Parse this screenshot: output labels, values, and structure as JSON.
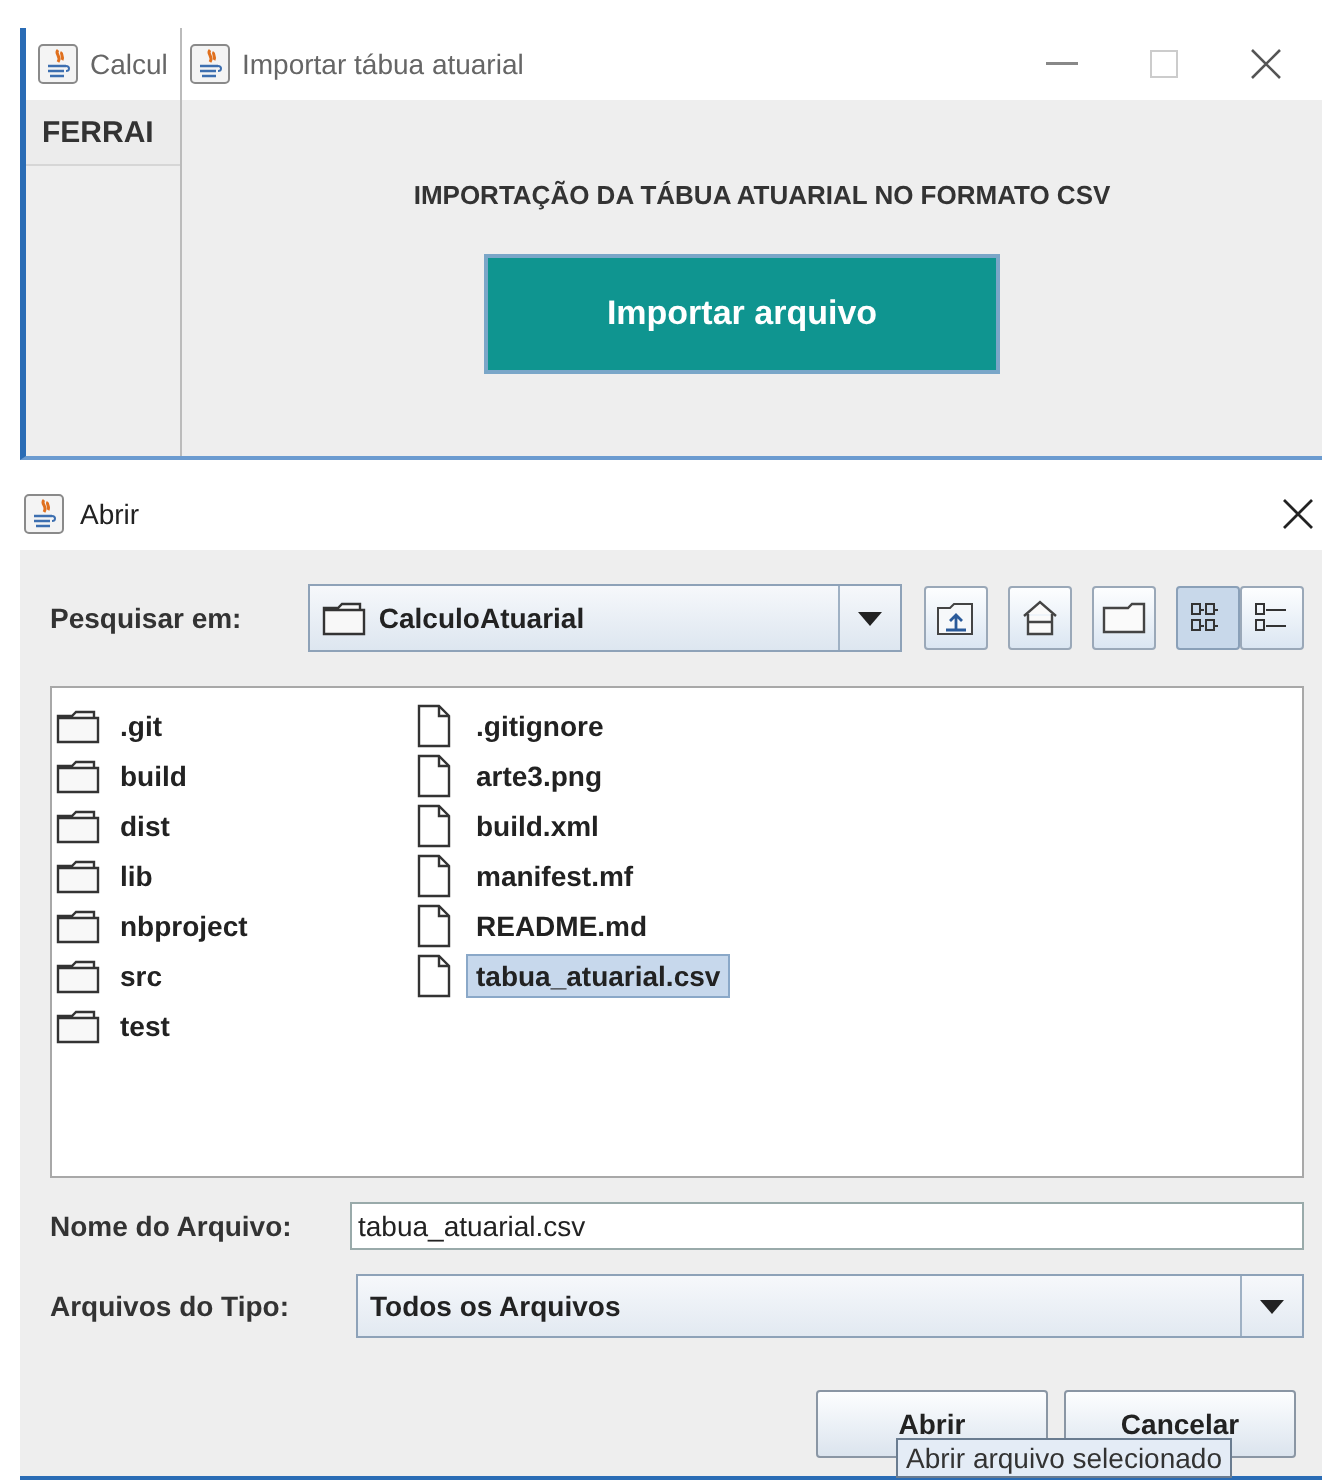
{
  "background_window": {
    "title": "Calcul",
    "menu": [
      "FERRAI"
    ]
  },
  "import_dialog": {
    "title": "Importar tábua atuarial",
    "heading": "IMPORTAÇÃO DA TÁBUA ATUARIAL NO FORMATO CSV",
    "button": "Importar arquivo"
  },
  "open_dialog": {
    "title": "Abrir",
    "look_in": {
      "label": "Pesquisar em:",
      "value": "CalculoAtuarial"
    },
    "toolbar": [
      {
        "kind": "up",
        "selected": false
      },
      {
        "kind": "home",
        "selected": false
      },
      {
        "kind": "new-folder",
        "selected": false
      },
      {
        "kind": "list",
        "selected": true
      },
      {
        "kind": "details",
        "selected": false
      }
    ],
    "files": [
      {
        "name": ".git",
        "kind": "folder",
        "selected": false
      },
      {
        "name": "build",
        "kind": "folder",
        "selected": false
      },
      {
        "name": "dist",
        "kind": "folder",
        "selected": false
      },
      {
        "name": "lib",
        "kind": "folder",
        "selected": false
      },
      {
        "name": "nbproject",
        "kind": "folder",
        "selected": false
      },
      {
        "name": "src",
        "kind": "folder",
        "selected": false
      },
      {
        "name": "test",
        "kind": "folder",
        "selected": false
      },
      {
        "name": ".gitignore",
        "kind": "file",
        "selected": false
      },
      {
        "name": "arte3.png",
        "kind": "file",
        "selected": false
      },
      {
        "name": "build.xml",
        "kind": "file",
        "selected": false
      },
      {
        "name": "manifest.mf",
        "kind": "file",
        "selected": false
      },
      {
        "name": "README.md",
        "kind": "file",
        "selected": false
      },
      {
        "name": "tabua_atuarial.csv",
        "kind": "file",
        "selected": true
      }
    ],
    "file_name": {
      "label": "Nome do Arquivo:",
      "value": "tabua_atuarial.csv"
    },
    "file_type": {
      "label": "Arquivos do Tipo:",
      "value": "Todos os Arquivos"
    },
    "buttons": [
      "Abrir",
      "Cancelar"
    ],
    "tooltip": "Abrir arquivo selecionado"
  }
}
